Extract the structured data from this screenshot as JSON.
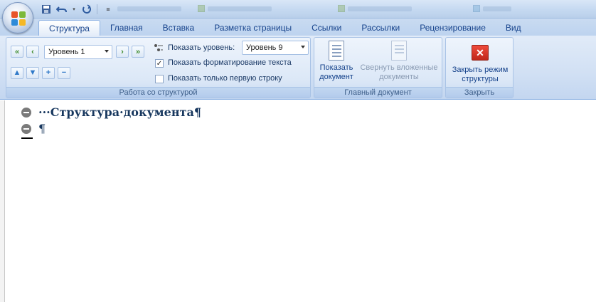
{
  "titlebar": {
    "qat": [
      "save-icon",
      "undo-icon",
      "redo-icon",
      "customize-icon"
    ]
  },
  "tabs": [
    {
      "label": "Структура",
      "active": true
    },
    {
      "label": "Главная"
    },
    {
      "label": "Вставка"
    },
    {
      "label": "Разметка страницы"
    },
    {
      "label": "Ссылки"
    },
    {
      "label": "Рассылки"
    },
    {
      "label": "Рецензирование"
    },
    {
      "label": "Вид"
    }
  ],
  "ribbon": {
    "outline_group": {
      "label": "Работа со структурой",
      "level_value": "Уровень 1",
      "show_level_label": "Показать уровень:",
      "show_level_value": "Уровень 9",
      "show_formatting_label": "Показать форматирование текста",
      "show_formatting_checked": true,
      "first_line_label": "Показать только первую строку",
      "first_line_checked": false
    },
    "master_group": {
      "label": "Главный документ",
      "show_document_label": "Показать документ",
      "show_document_lines": [
        "Показать",
        "документ"
      ],
      "collapse_lines": [
        "Свернуть вложенные",
        "документы"
      ]
    },
    "close_group": {
      "label": "Закрыть",
      "close_lines": [
        "Закрыть режим",
        "структуры"
      ]
    }
  },
  "document": {
    "heading": "···Структура·документа¶",
    "empty_line": "¶"
  }
}
